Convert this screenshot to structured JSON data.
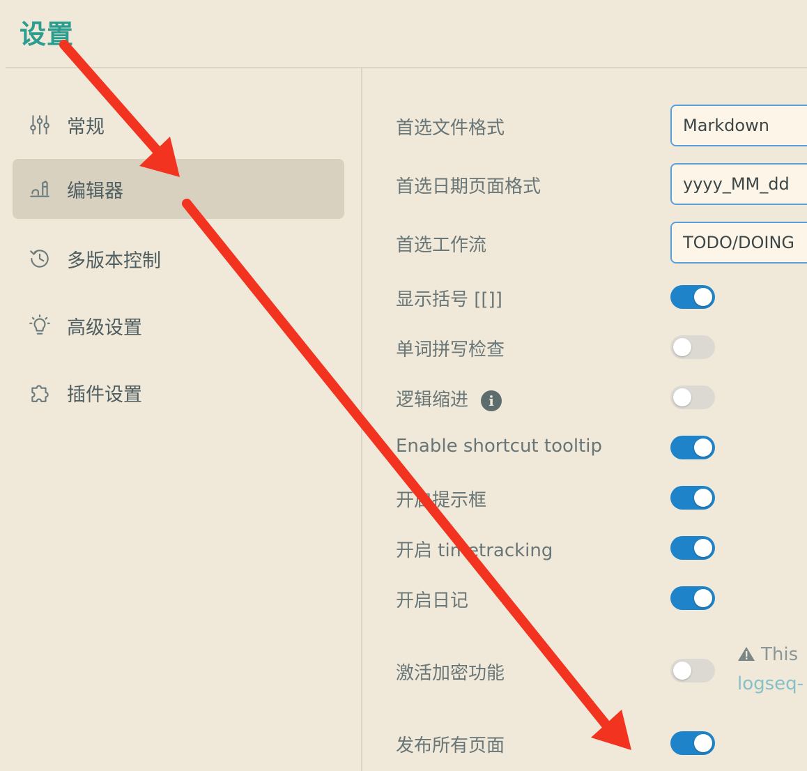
{
  "page": {
    "title": "设置"
  },
  "sidebar": {
    "items": [
      {
        "label": "常规",
        "icon": "sliders-icon",
        "active": false
      },
      {
        "label": "编辑器",
        "icon": "editor-icon",
        "active": true
      },
      {
        "label": "多版本控制",
        "icon": "history-icon",
        "active": false
      },
      {
        "label": "高级设置",
        "icon": "lightbulb-icon",
        "active": false
      },
      {
        "label": "插件设置",
        "icon": "puzzle-icon",
        "active": false
      }
    ]
  },
  "editor_settings": {
    "file_format": {
      "label": "首选文件格式",
      "value": "Markdown"
    },
    "date_format": {
      "label": "首选日期页面格式",
      "value": "yyyy_MM_dd"
    },
    "workflow": {
      "label": "首选工作流",
      "value": "TODO/DOING"
    },
    "show_brackets": {
      "label": "显示括号 [[]]",
      "enabled": true
    },
    "spell_check": {
      "label": "单词拼写检查",
      "enabled": false
    },
    "logical_indent": {
      "label": "逻辑缩进",
      "enabled": false,
      "info_icon": "info-icon",
      "info_glyph": "i"
    },
    "shortcut_tooltip": {
      "label": "Enable shortcut tooltip",
      "enabled": true
    },
    "tooltip": {
      "label": "开启提示框",
      "enabled": true
    },
    "time_tracking": {
      "label": "开启 timetracking",
      "enabled": true
    },
    "journals": {
      "label": "开启日记",
      "enabled": true
    },
    "encryption": {
      "label": "激活加密功能",
      "enabled": false,
      "warning_text": "This",
      "warning_link": "logseq-"
    },
    "publish_all": {
      "label": "发布所有页面",
      "enabled": true
    }
  },
  "colors": {
    "background": "#f0e8d8",
    "title": "#2a9d8f",
    "toggle_on": "#1f83c9",
    "toggle_off": "#dbd9d2",
    "annotation_arrow": "#f2331f"
  }
}
